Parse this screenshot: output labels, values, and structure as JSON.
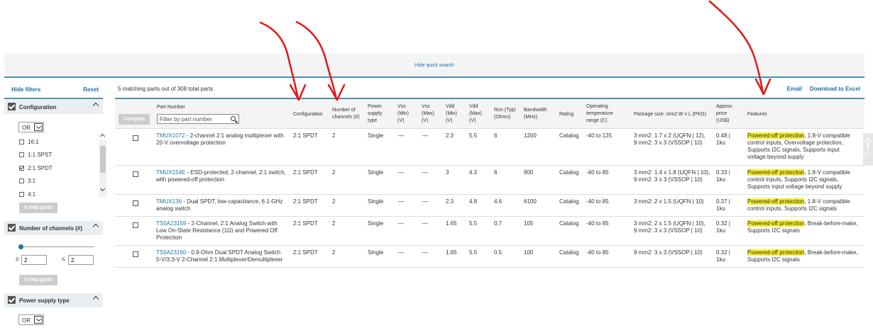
{
  "quick_search": {
    "label": "Hide quick search"
  },
  "filters": {
    "hide_label": "Hide filters",
    "reset_label": "Reset",
    "configuration": {
      "title": "Configuration",
      "operator": "OR",
      "options": [
        {
          "label": "16:1",
          "checked": false
        },
        {
          "label": "1:1 SPST",
          "checked": false
        },
        {
          "label": "2:1 SPDT",
          "checked": true
        },
        {
          "label": "3:1",
          "checked": false
        },
        {
          "label": "4:1",
          "checked": false
        }
      ],
      "total_label": "5 total parts"
    },
    "channels": {
      "title": "Number of channels (#)",
      "min_symbol": "≥",
      "max_symbol": "≤",
      "min_value": "2",
      "max_value": "2",
      "total_label": "5 total parts"
    },
    "supply": {
      "title": "Power supply type",
      "operator": "OR"
    }
  },
  "results": {
    "summary": "5 matching parts out of 308 total parts",
    "email_label": "Email",
    "download_label": "Download to Excel",
    "compare_label": "Compare",
    "part_filter_placeholder": "Filter by part number"
  },
  "columns": {
    "part_number": "Part Number",
    "configuration": "Configuration",
    "channels": [
      "Number of",
      "channels (#)"
    ],
    "supply": [
      "Power",
      "supply",
      "type"
    ],
    "vss_min": [
      "Vss",
      "(Min)",
      "(V)"
    ],
    "vss_max": [
      "Vss",
      "(Max)",
      "(V)"
    ],
    "vdd_min": [
      "Vdd",
      "(Min)",
      "(V)"
    ],
    "vdd_max": [
      "Vdd",
      "(Max)",
      "(V)"
    ],
    "ron": [
      "Ron (Typ)",
      "(Ohms)"
    ],
    "bandwidth": [
      "Bandwidth",
      "(MHz)"
    ],
    "rating": "Rating",
    "temp": [
      "Operating",
      "temperature",
      "range (C)"
    ],
    "package": "Package size: mm2:W x L (PKG)",
    "price": [
      "Approx.",
      "price",
      "(US$)"
    ],
    "features": "Features"
  },
  "rows": [
    {
      "part": "TMUX1072",
      "desc": [
        " - 2-channel 2:1 analog multiplexer with",
        "20-V overvoltage protection"
      ],
      "config": "2:1 SPDT",
      "channels": "2",
      "supply": "Single",
      "vss_min": "—",
      "vss_max": "—",
      "vdd_min": "2.3",
      "vdd_max": "5.5",
      "ron": "6",
      "bandwidth": "1200",
      "rating": "Catalog",
      "temp": "-40 to 125",
      "package": [
        "3 mm2: 1.7 x 2 (UQFN | 12),",
        "9 mm2: 3 x 3 (VSSOP | 10)"
      ],
      "price": [
        "0.48 |",
        "1ku"
      ],
      "features_hl": "Powered-off protection",
      "features": [
        ", 1.8-V compatible",
        "control inputs, Overvoltage protection,",
        "Supports I2C signals, Supports input",
        "voltage beyond supply"
      ]
    },
    {
      "part": "TMUX154E",
      "desc": [
        " - ESD-protected, 2-channel, 2:1 switch,",
        "with powered-off protection"
      ],
      "config": "2:1 SPDT",
      "channels": "2",
      "supply": "Single",
      "vss_min": "—",
      "vss_max": "—",
      "vdd_min": "3",
      "vdd_max": "4.3",
      "ron": "6",
      "bandwidth": "900",
      "rating": "Catalog",
      "temp": "-40 to 85",
      "package": [
        "3 mm2: 1.4 x 1.8 (UQFN | 10),",
        "9 mm2: 3 x 3 (VSSOP | 10)"
      ],
      "price": [
        "0.33 |",
        "1ku"
      ],
      "features_hl": "Powered-off protection",
      "features": [
        ", 1.8-V compatible",
        "control inputs, Supports I2C signals,",
        "Supports input voltage beyond supply"
      ]
    },
    {
      "part": "TMUX136",
      "desc": [
        " - Dual SPDT, low-capacitance, 6.1-GHz",
        "analog switch"
      ],
      "config": "2:1 SPDT",
      "channels": "2",
      "supply": "Single",
      "vss_min": "—",
      "vss_max": "—",
      "vdd_min": "2.3",
      "vdd_max": "4.8",
      "ron": "4.6",
      "bandwidth": "6100",
      "rating": "Catalog",
      "temp": "-40 to 85",
      "package": [
        "3 mm2: 2 x 1.5 (UQFN | 10)"
      ],
      "price": [
        "0.37 |",
        "1ku"
      ],
      "features_hl": "Powered-off protection",
      "features": [
        ", 1.8-V compatible",
        "control inputs, Supports I2C signals"
      ]
    },
    {
      "part": "TS5A23159",
      "desc": [
        " - 2-Channel, 2:1 Analog Switch with",
        "Low On-State Resistance (1Ω) and Powered Off",
        "Protection"
      ],
      "config": "2:1 SPDT",
      "channels": "2",
      "supply": "Single",
      "vss_min": "—",
      "vss_max": "—",
      "vdd_min": "1.65",
      "vdd_max": "5.5",
      "ron": "0.7",
      "bandwidth": "105",
      "rating": "Catalog",
      "temp": "-40 to 85",
      "package": [
        "3 mm2: 2 x 1.5 (UQFN | 10),",
        "9 mm2: 3 x 3 (VSSOP | 10)"
      ],
      "price": [
        "0.32 |",
        "1ku"
      ],
      "features_hl": "Powered-off protection",
      "features": [
        ", Break-before-make,",
        "Supports I2C signals"
      ]
    },
    {
      "part": "TS5A23160",
      "desc": [
        " - 0.9-Ohm Dual SPDT Analog Switch",
        "5-V/3.3-V 2-Channel 2:1 Multiplexer/Demultiplexer"
      ],
      "config": "2:1 SPDT",
      "channels": "2",
      "supply": "Single",
      "vss_min": "—",
      "vss_max": "—",
      "vdd_min": "1.65",
      "vdd_max": "5.5",
      "ron": "0.5",
      "bandwidth": "100",
      "rating": "Catalog",
      "temp": "-40 to 85",
      "package": [
        "9 mm2: 3 x 3 (VSSOP | 10)"
      ],
      "price": [
        "0.32 |",
        "1ku"
      ],
      "features_hl": "Powered-off protection",
      "features": [
        ", Break-before-make,",
        "Supports I2C signals"
      ]
    }
  ],
  "to_top_label": "TO",
  "colors": {
    "link": "#1a73a8",
    "accent_rule": "#4c8fb0",
    "highlight": "#f5ee2a",
    "annotation": "#e01818"
  }
}
